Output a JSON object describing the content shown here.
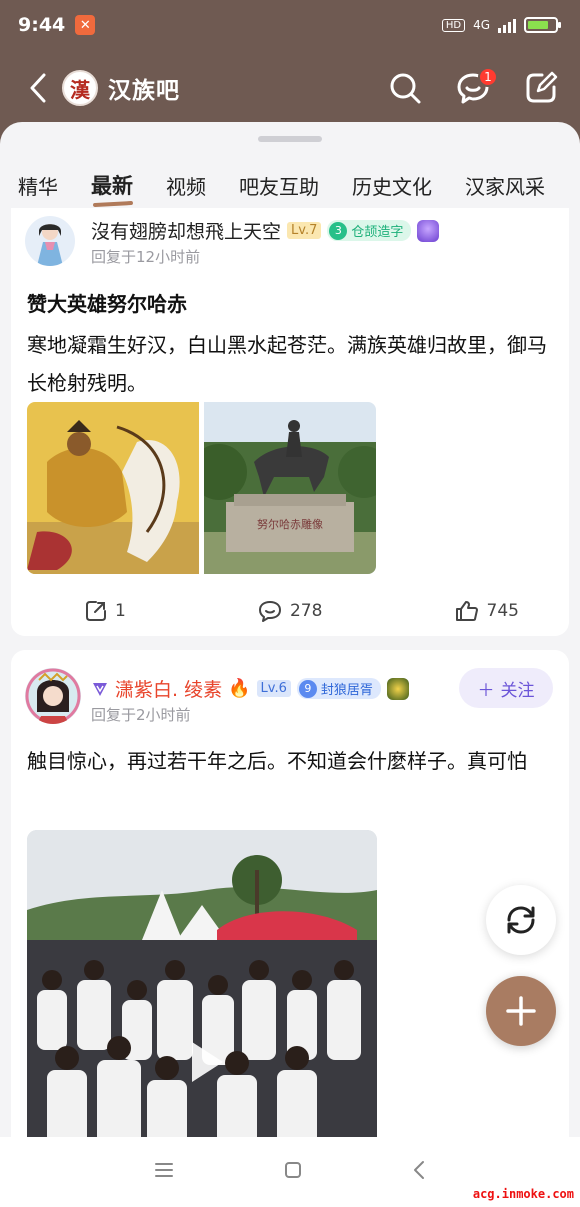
{
  "status_bar": {
    "time": "9:44",
    "network": "4G",
    "hd": "HD"
  },
  "header": {
    "forum_name": "汉族吧",
    "forum_logo_char": "漢",
    "message_count": "1"
  },
  "tabs": [
    {
      "label": "精华"
    },
    {
      "label": "最新"
    },
    {
      "label": "视频"
    },
    {
      "label": "吧友互助"
    },
    {
      "label": "历史文化"
    },
    {
      "label": "汉家风采"
    }
  ],
  "posts": [
    {
      "username": "沒有翅膀却想飛上天空",
      "level": "Lv.7",
      "badge_num": "3",
      "badge_text": "仓颉造字",
      "reply_time": "回复于12小时前",
      "title": "赞大英雄努尔哈赤",
      "body": "寒地凝霜生好汉，白山黑水起苍茫。满族英雄归故里，御马长枪射残明。",
      "share_count": "1",
      "comment_count": "278",
      "like_count": "745",
      "statue_text": "努尔哈赤雕像"
    },
    {
      "username": "潇紫白. 绫素",
      "level": "Lv.6",
      "badge_num": "9",
      "badge_text": "封狼居胥",
      "reply_time": "回复于2小时前",
      "follow_label": "关注",
      "body": "触目惊心，再过若干年之后。不知道会什麼样子。真可怕"
    }
  ],
  "watermark": "acg.inmoke.com",
  "colors": {
    "header_bg": "#6f5a52",
    "accent": "#a97c62",
    "vip_name": "#e8452c"
  }
}
